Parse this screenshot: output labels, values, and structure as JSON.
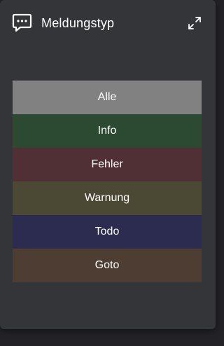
{
  "panel": {
    "title": "Meldungstyp",
    "header_icon": "message-dots-icon",
    "expand_icon": "expand-arrows-icon"
  },
  "types": [
    {
      "label": "Alle",
      "color": "#818181"
    },
    {
      "label": "Info",
      "color": "#2c4a31"
    },
    {
      "label": "Fehler",
      "color": "#502f35"
    },
    {
      "label": "Warnung",
      "color": "#4b4833"
    },
    {
      "label": "Todo",
      "color": "#2c2c50"
    },
    {
      "label": "Goto",
      "color": "#4e3d32"
    }
  ]
}
